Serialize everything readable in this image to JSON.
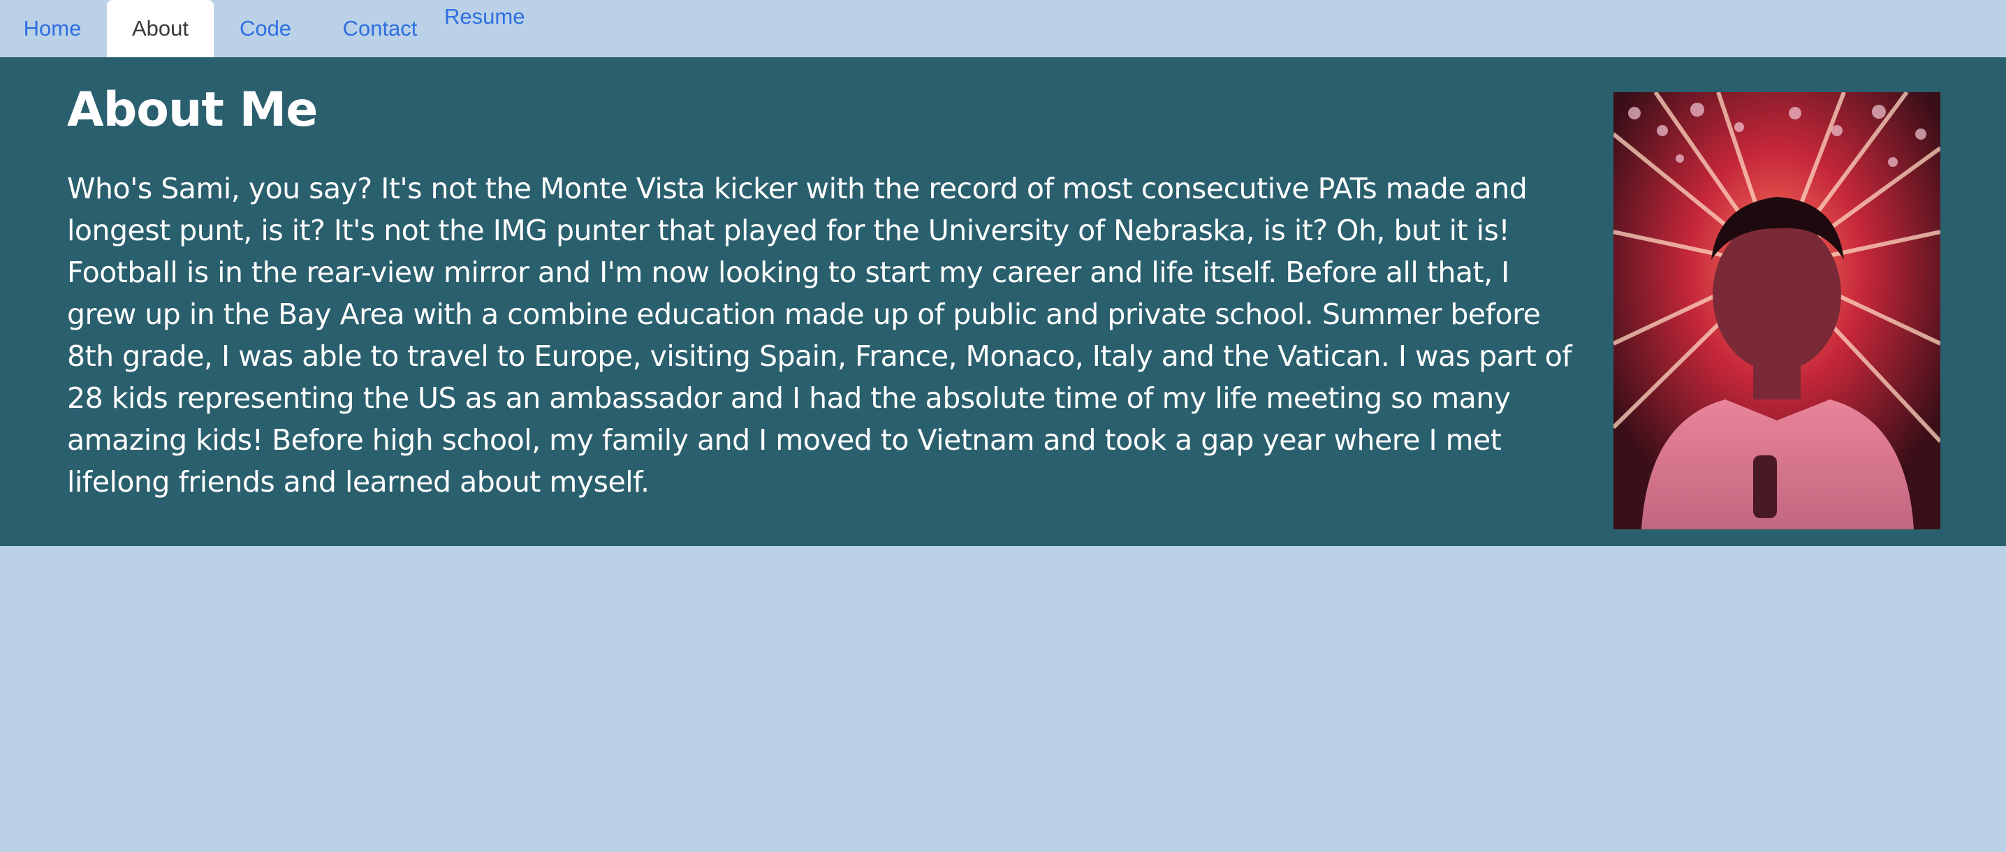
{
  "nav": {
    "items": [
      {
        "label": "Home"
      },
      {
        "label": "About"
      },
      {
        "label": "Code"
      },
      {
        "label": "Contact"
      },
      {
        "label": "Resume"
      }
    ],
    "active": "About"
  },
  "about": {
    "title": "About Me",
    "body": "Who's Sami, you say? It's not the Monte Vista kicker with the record of most consecutive PATs made and longest punt, is it? It's not the IMG punter that played for the University of Nebraska, is it? Oh, but it is! Football is in the rear-view mirror and I'm now looking to start my career and life itself. Before all that, I grew up in the Bay Area with a combine education made up of public and private school. Summer before 8th grade, I was able to travel to Europe, visiting Spain, France, Monaco, Italy and the Vatican. I was part of 28 kids representing the US as an ambassador and I had the absolute time of my life meeting so many amazing kids! Before high school, my family and I moved to Vietnam and took a gap year where I met lifelong friends and learned about myself."
  },
  "colors": {
    "page_bg": "#bad1e8",
    "band_bg": "#2a5f6e",
    "nav_link": "#2f6fe0",
    "text": "#ffffff"
  }
}
